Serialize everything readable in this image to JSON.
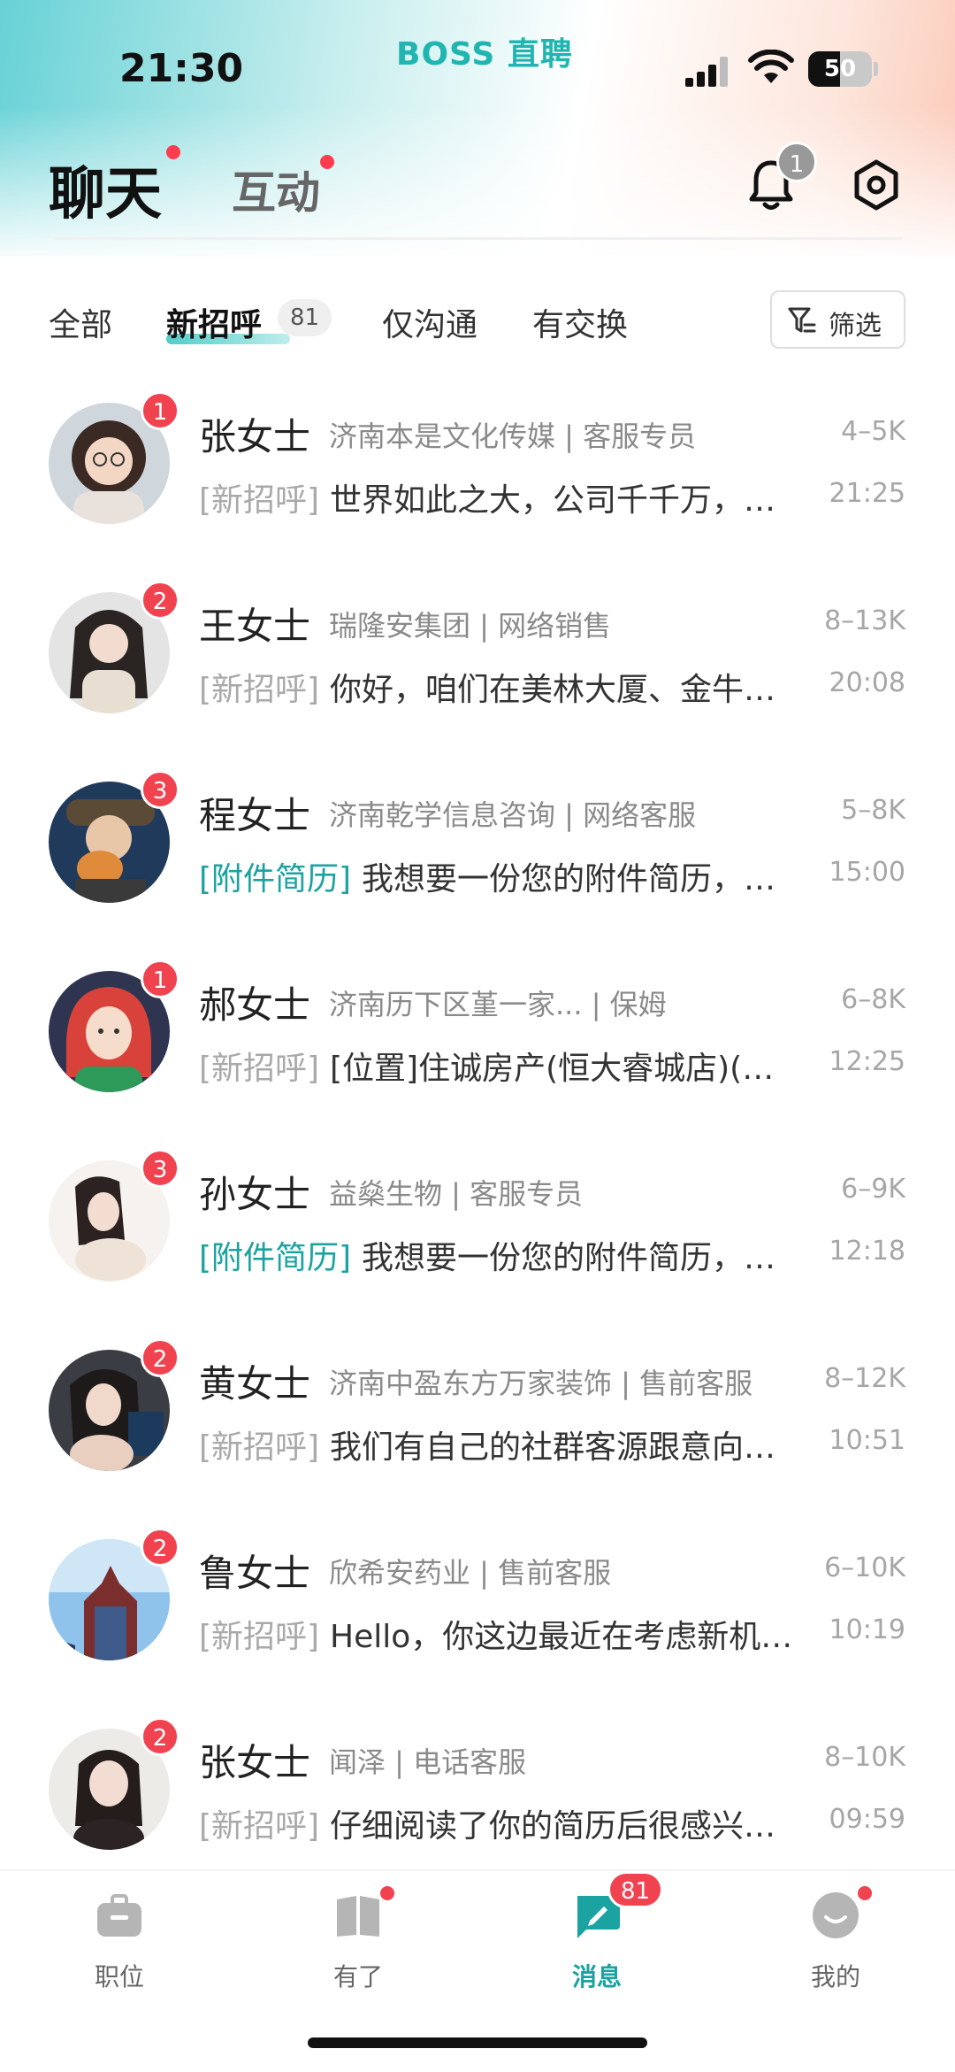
{
  "status_bar": {
    "time": "21:30",
    "brand": "BOSS 直聘",
    "battery": "50",
    "battery_level": 0.5
  },
  "header": {
    "title": "聊天",
    "secondary_tab": "互动",
    "notification_count": "1"
  },
  "filter_tabs": {
    "all": "全部",
    "new_greeting": "新招呼",
    "new_greeting_count": "81",
    "only_chat": "仅沟通",
    "exchanged": "有交换",
    "filter_label": "筛选"
  },
  "chats": [
    {
      "name": "张女士",
      "company": "济南本是文化传媒 | 客服专员",
      "salary": "4–5K",
      "tag": "[新招呼]",
      "tag_type": "gray",
      "message": "世界如此之大，公司千千万，…",
      "time": "21:25",
      "unread": "1"
    },
    {
      "name": "王女士",
      "company": "瑞隆安集团 | 网络销售",
      "salary": "8–13K",
      "tag": "[新招呼]",
      "tag_type": "gray",
      "message": "你好，咱们在美林大厦、金牛…",
      "time": "20:08",
      "unread": "2"
    },
    {
      "name": "程女士",
      "company": "济南乾学信息咨询 | 网络客服",
      "salary": "5–8K",
      "tag": "[附件简历]",
      "tag_type": "teal",
      "message": "我想要一份您的附件简历，…",
      "time": "15:00",
      "unread": "3"
    },
    {
      "name": "郝女士",
      "company": "济南历下区堇一家... | 保姆",
      "salary": "6–8K",
      "tag": "[新招呼]",
      "tag_type": "gray",
      "message": "[位置]住诚房产(恒大睿城店)(…",
      "time": "12:25",
      "unread": "1"
    },
    {
      "name": "孙女士",
      "company": "益燊生物 | 客服专员",
      "salary": "6–9K",
      "tag": "[附件简历]",
      "tag_type": "teal",
      "message": "我想要一份您的附件简历，…",
      "time": "12:18",
      "unread": "3"
    },
    {
      "name": "黄女士",
      "company": "济南中盈东方万家装饰 | 售前客服",
      "salary": "8–12K",
      "tag": "[新招呼]",
      "tag_type": "gray",
      "message": "我们有自己的社群客源跟意向…",
      "time": "10:51",
      "unread": "2"
    },
    {
      "name": "鲁女士",
      "company": "欣希安药业 | 售前客服",
      "salary": "6–10K",
      "tag": "[新招呼]",
      "tag_type": "gray",
      "message": "Hello，你这边最近在考虑新机…",
      "time": "10:19",
      "unread": "2"
    },
    {
      "name": "张女士",
      "company": "闻泽 | 电话客服",
      "salary": "8–10K",
      "tag": "[新招呼]",
      "tag_type": "gray",
      "message": "仔细阅读了你的简历后很感兴…",
      "time": "09:59",
      "unread": "2"
    }
  ],
  "bottom_nav": {
    "jobs": "职位",
    "youle": "有了",
    "messages": "消息",
    "messages_badge": "81",
    "mine": "我的"
  },
  "colors": {
    "accent": "#1aa3a0",
    "badge": "#f0424f",
    "muted": "#a6a6a6"
  }
}
